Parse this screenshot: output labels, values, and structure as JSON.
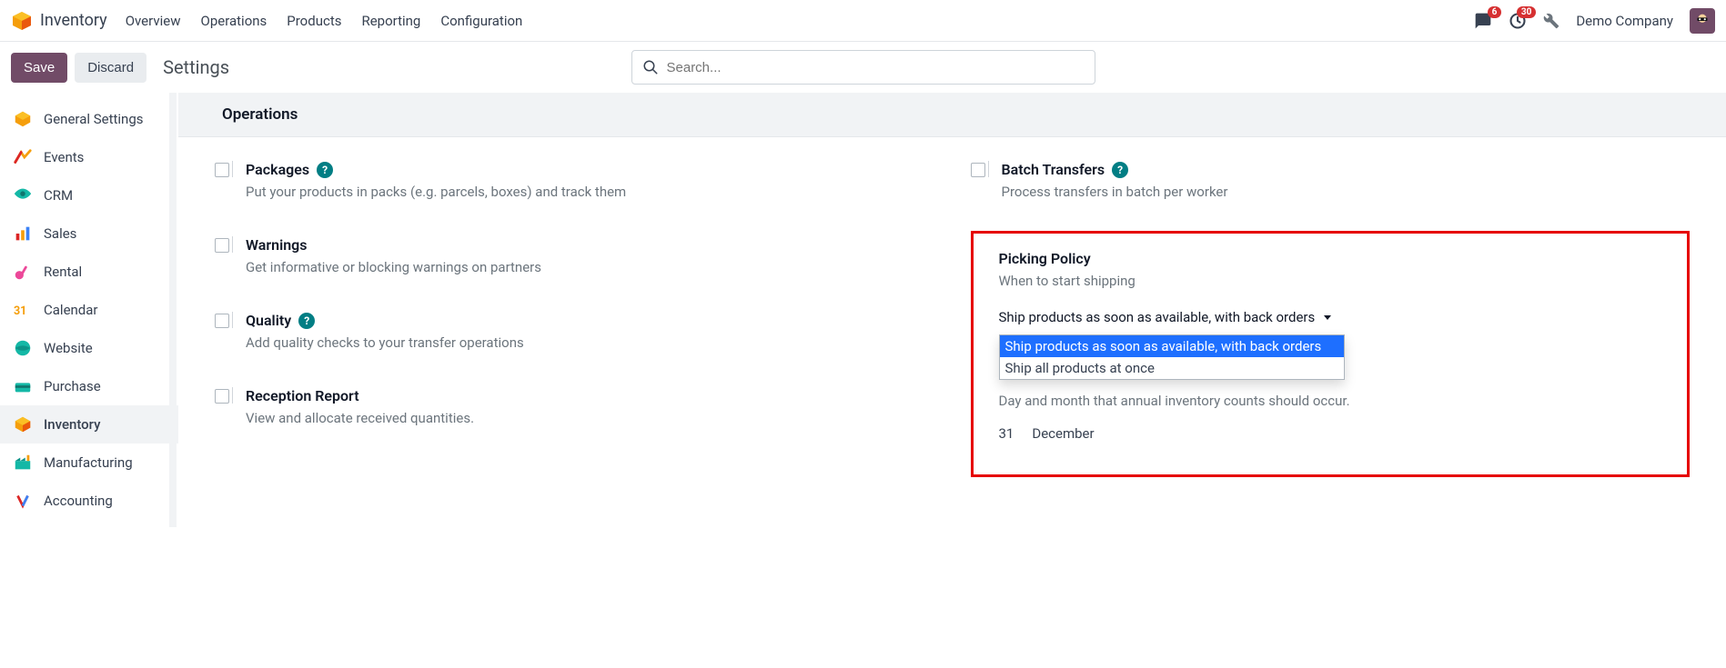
{
  "app_title": "Inventory",
  "nav_menu": [
    "Overview",
    "Operations",
    "Products",
    "Reporting",
    "Configuration"
  ],
  "notif_count": "6",
  "activity_count": "30",
  "company_name": "Demo Company",
  "save_label": "Save",
  "discard_label": "Discard",
  "settings_label": "Settings",
  "search_placeholder": "Search...",
  "sidebar": [
    {
      "label": "General Settings"
    },
    {
      "label": "Events"
    },
    {
      "label": "CRM"
    },
    {
      "label": "Sales"
    },
    {
      "label": "Rental"
    },
    {
      "label": "Calendar"
    },
    {
      "label": "Website"
    },
    {
      "label": "Purchase"
    },
    {
      "label": "Inventory"
    },
    {
      "label": "Manufacturing"
    },
    {
      "label": "Accounting"
    }
  ],
  "section_title": "Operations",
  "settings": {
    "packages": {
      "title": "Packages",
      "desc": "Put your products in packs (e.g. parcels, boxes) and track them"
    },
    "batch": {
      "title": "Batch Transfers",
      "desc": "Process transfers in batch per worker"
    },
    "warnings": {
      "title": "Warnings",
      "desc": "Get informative or blocking warnings on partners"
    },
    "picking": {
      "title": "Picking Policy",
      "desc": "When to start shipping"
    },
    "quality": {
      "title": "Quality",
      "desc": "Add quality checks to your transfer operations"
    },
    "reception": {
      "title": "Reception Report",
      "desc": "View and allocate received quantities."
    },
    "annual_desc": "Day and month that annual inventory counts should occur.",
    "annual_day": "31",
    "annual_month": "December"
  },
  "picking_select": {
    "current": "Ship products as soon as available, with back orders",
    "options": [
      "Ship products as soon as available, with back orders",
      "Ship all products at once"
    ]
  }
}
